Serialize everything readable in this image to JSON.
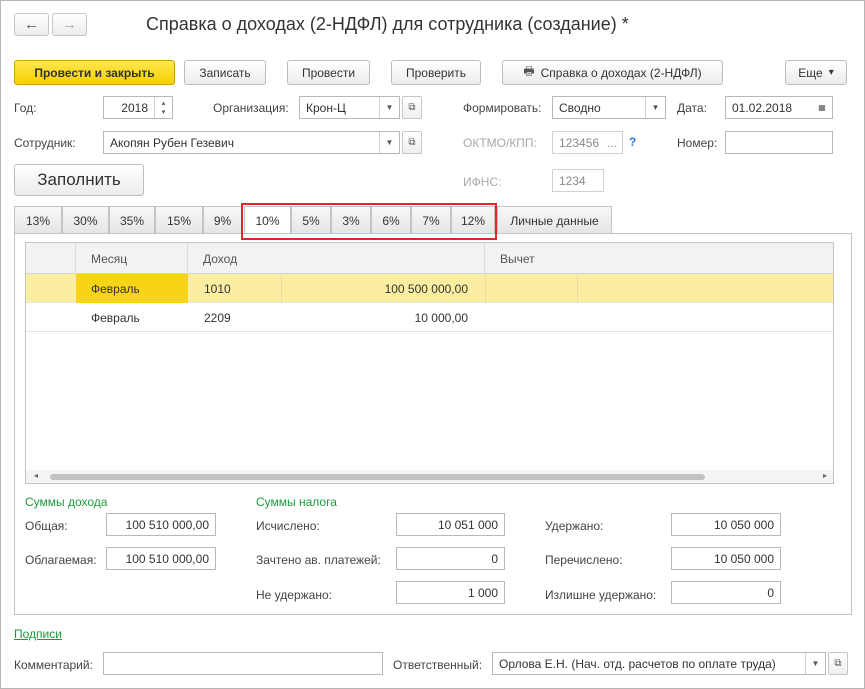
{
  "window": {
    "title": "Справка о доходах (2-НДФЛ) для сотрудника (создание) *",
    "back_icon": "←",
    "forward_icon": "→"
  },
  "toolbar": {
    "post_close": "Провести и закрыть",
    "save": "Записать",
    "post": "Провести",
    "check": "Проверить",
    "print_icon": "🖶",
    "certificate": "Справка о доходах (2-НДФЛ)",
    "more": "Еще",
    "more_arrow": "▾"
  },
  "form": {
    "year_label": "Год:",
    "year_value": "2018",
    "org_label": "Организация:",
    "org_value": "Крон-Ц",
    "form_label": "Формировать:",
    "form_value": "Сводно",
    "date_label": "Дата:",
    "date_value": "01.02.2018",
    "employee_label": "Сотрудник:",
    "employee_value": "Акопян Рубен Гезевич",
    "oktmo_label": "ОКТМО/КПП:",
    "oktmo_value": "123456",
    "oktmo_ellipsis": "...",
    "help_mark": "?",
    "number_label": "Номер:",
    "number_value": "",
    "ifns_label": "ИФНС:",
    "ifns_value": "1234",
    "fill_button": "Заполнить"
  },
  "tabs": [
    "13%",
    "30%",
    "35%",
    "15%",
    "9%",
    "10%",
    "5%",
    "3%",
    "6%",
    "7%",
    "12%",
    "Личные данные"
  ],
  "active_tab": "10%",
  "table": {
    "columns": [
      "Месяц",
      "Доход",
      "Вычет"
    ],
    "rows": [
      {
        "month": "Февраль",
        "code": "1010",
        "amount": "100 500 000,00"
      },
      {
        "month": "Февраль",
        "code": "2209",
        "amount": "10 000,00"
      }
    ]
  },
  "income": {
    "title": "Суммы дохода",
    "total_label": "Общая:",
    "total_value": "100 510 000,00",
    "taxable_label": "Облагаемая:",
    "taxable_value": "100 510 000,00"
  },
  "tax": {
    "title": "Суммы налога",
    "calculated_label": "Исчислено:",
    "calculated_value": "10 051 000",
    "offset_label": "Зачтено ав. платежей:",
    "offset_value": "0",
    "not_withheld_label": "Не удержано:",
    "not_withheld_value": "1 000",
    "withheld_label": "Удержано:",
    "withheld_value": "10 050 000",
    "transferred_label": "Перечислено:",
    "transferred_value": "10 050 000",
    "over_withheld_label": "Излишне удержано:",
    "over_withheld_value": "0"
  },
  "footer": {
    "signatures_link": "Подписи",
    "comment_label": "Комментарий:",
    "comment_value": "",
    "responsible_label": "Ответственный:",
    "responsible_value": "Орлова Е.Н. (Нач. отд. расчетов по оплате труда)"
  },
  "colors": {
    "primary_button": "#f7cf00",
    "selected_row": "#fbeea0",
    "selected_cell": "#f7d417",
    "section_title": "#1e9a3a",
    "highlight_border": "#e2252b"
  }
}
